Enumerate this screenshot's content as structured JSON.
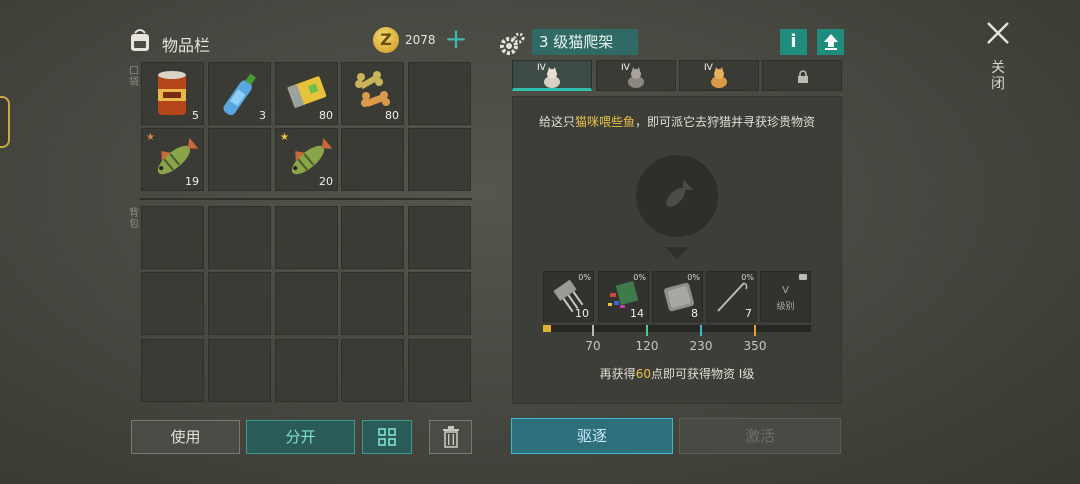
{
  "inventory": {
    "title": "物品栏",
    "coins": "2078",
    "plus_label": "+",
    "pocket_label": "口袋",
    "backpack_label": "背包",
    "pocket_slots": [
      {
        "item": "canned-food-icon",
        "count": "5"
      },
      {
        "item": "water-bottle-icon",
        "count": "3"
      },
      {
        "item": "battery-icon",
        "count": "80"
      },
      {
        "item": "dog-bone-icon",
        "count": "80"
      },
      {
        "item": "",
        "count": ""
      },
      {
        "item": "perch-fish-icon",
        "count": "19",
        "star": "bronze"
      },
      {
        "item": "",
        "count": ""
      },
      {
        "item": "perch-fish-icon",
        "count": "20",
        "star": "gold"
      },
      {
        "item": "",
        "count": ""
      },
      {
        "item": "",
        "count": ""
      }
    ],
    "buttons": {
      "use": "使用",
      "split": "分开",
      "trash_icon": "trash-icon",
      "grid_icon": "grid-icon"
    }
  },
  "cat_tree": {
    "title": "3 级猫爬架",
    "info_label": "i",
    "upgrade_icon": "upgrade-arrow-icon",
    "tabs": [
      {
        "level": "IV",
        "icon": "cat-icon",
        "active": true
      },
      {
        "level": "IV",
        "icon": "cat-icon",
        "active": false
      },
      {
        "level": "IV",
        "icon": "cat-icon",
        "active": false
      },
      {
        "level": "",
        "icon": "lock-icon",
        "active": false
      }
    ],
    "hint_prefix": "给这只",
    "hint_highlight": "猫咪喂些鱼",
    "hint_suffix": "，即可派它去狩猎并寻获珍贵物资",
    "rewards": [
      {
        "icon": "transistor-icon",
        "percent": "0%",
        "count": "10"
      },
      {
        "icon": "colored-parts-icon",
        "percent": "0%",
        "count": "14"
      },
      {
        "icon": "metal-plate-icon",
        "percent": "0%",
        "count": "8"
      },
      {
        "icon": "wire-icon",
        "percent": "0%",
        "count": "7"
      }
    ],
    "locked_level": "V",
    "locked_level_label": "级别",
    "thresholds": [
      "70",
      "120",
      "230",
      "350"
    ],
    "progress_fraction": 0.03,
    "progress_prefix": "再获得",
    "progress_points": "60",
    "progress_suffix": "点即可获得物资 I级",
    "expel_label": "驱逐",
    "activate_label": "激活"
  },
  "close_label": "关闭",
  "colors": {
    "accent": "#2fbfae",
    "gold": "#e8c24a"
  }
}
